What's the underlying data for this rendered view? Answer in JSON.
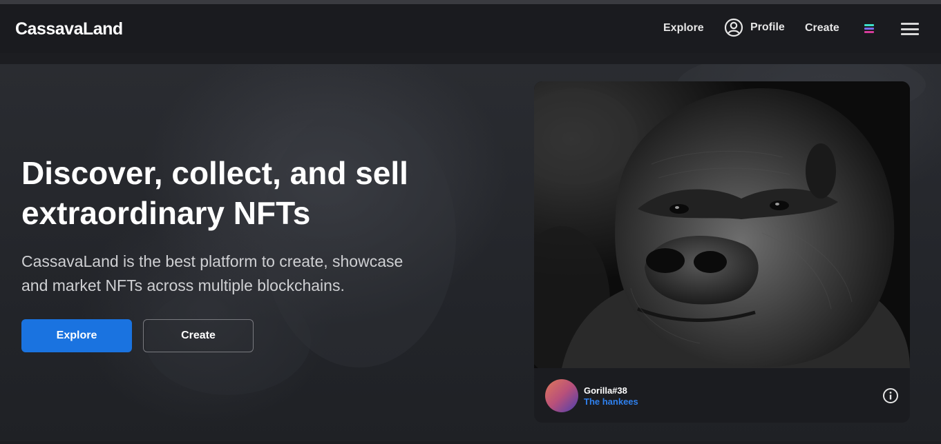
{
  "header": {
    "logo": "CassavaLand",
    "nav": {
      "explore": "Explore",
      "profile": "Profile",
      "create": "Create"
    },
    "icons": [
      "profile-icon",
      "chain-icon",
      "menu-icon"
    ]
  },
  "hero": {
    "headline_line1": "Discover, collect, and sell",
    "headline_line2": "extraordinary NFTs",
    "subtext_line1": "CassavaLand is the best platform to create, showcase",
    "subtext_line2": "and market NFTs across multiple blockchains.",
    "explore_button": "Explore",
    "create_button": "Create"
  },
  "featured": {
    "title": "Gorilla#38",
    "collection": "The hankees",
    "icons": [
      "info-icon"
    ]
  },
  "colors": {
    "accent": "#1a73e0",
    "link": "#2f80ed",
    "background": "#1c1d21"
  }
}
